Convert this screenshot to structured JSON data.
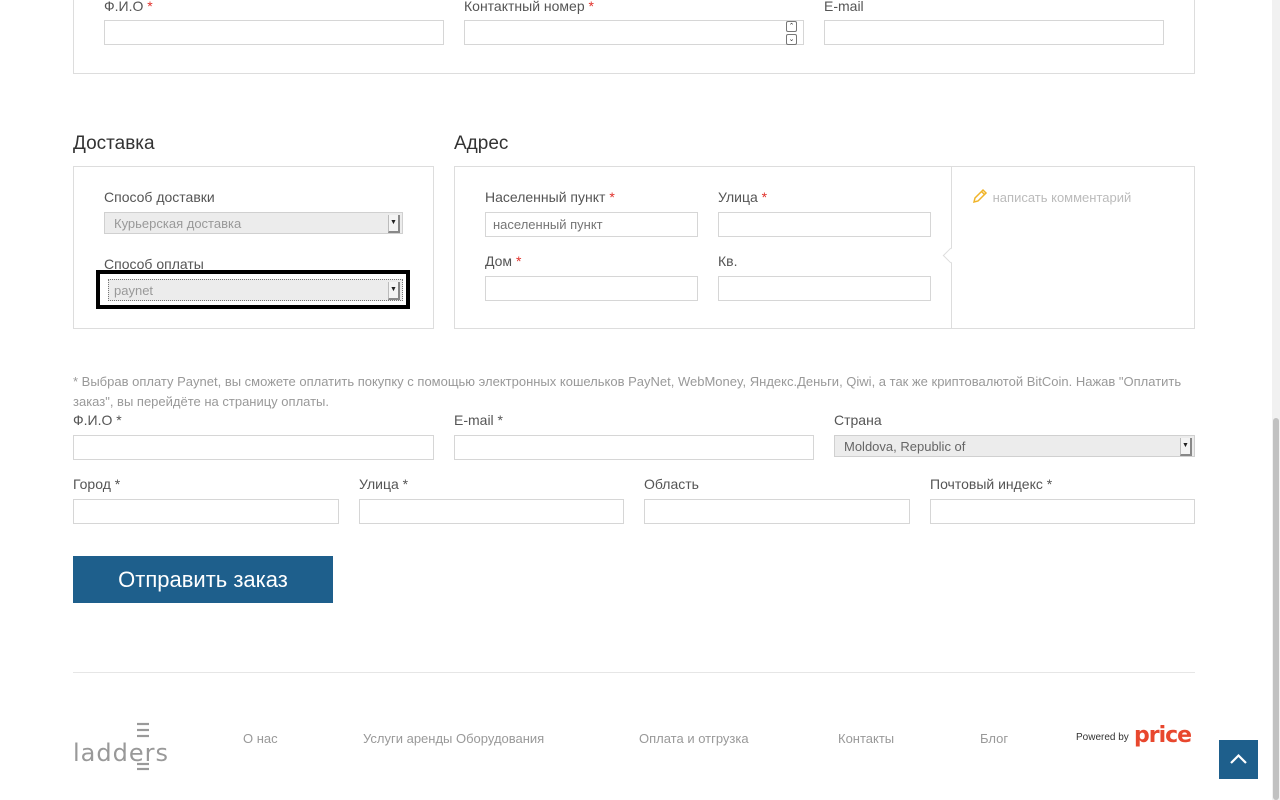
{
  "contact": {
    "fio_label": "Ф.И.О",
    "phone_label": "Контактный номер",
    "email_label": "E-mail",
    "required_mark": "*"
  },
  "delivery": {
    "heading": "Доставка",
    "method_label": "Способ доставки",
    "method_value": "Курьерская доставка",
    "payment_label": "Способ оплаты",
    "payment_value": "paynet"
  },
  "address": {
    "heading": "Адрес",
    "locality_label": "Населенный пункт",
    "locality_placeholder": "населенный пункт",
    "street_label": "Улица",
    "house_label": "Дом",
    "apt_label": "Кв.",
    "comment_link": "написать комментарий"
  },
  "paynet_note": "* Выбрав оплату Paynet, вы сможете оплатить покупку с помощью электронных кошельков PayNet, WebMoney, Яндекс.Деньги, Qiwi, а так же криптовалютой BitCoin. Нажав \"Оплатить заказ\", вы перейдёте на страницу оплаты.",
  "billing": {
    "fio_label": "Ф.И.О *",
    "email_label": "E-mail *",
    "country_label": "Страна",
    "country_value": "Moldova, Republic of",
    "city_label": "Город *",
    "street_label": "Улица *",
    "region_label": "Область",
    "zip_label": "Почтовый индекс *"
  },
  "submit_label": "Отправить заказ",
  "footer": {
    "logo_text": "ladders",
    "links": [
      "О нас",
      "Услуги аренды Оборудования",
      "Оплата и отгрузка",
      "Контакты",
      "Блог"
    ],
    "powered_by": "Powered by",
    "price_brand": "price"
  },
  "colors": {
    "accent": "#1e5f8c",
    "required": "#e0302a",
    "pencil": "#f0b429"
  },
  "icons": {
    "comment": "pencil-icon",
    "spin": "spin-arrows-icon",
    "select": "dropdown-arrow-icon",
    "scroll_top": "chevron-up-icon"
  }
}
